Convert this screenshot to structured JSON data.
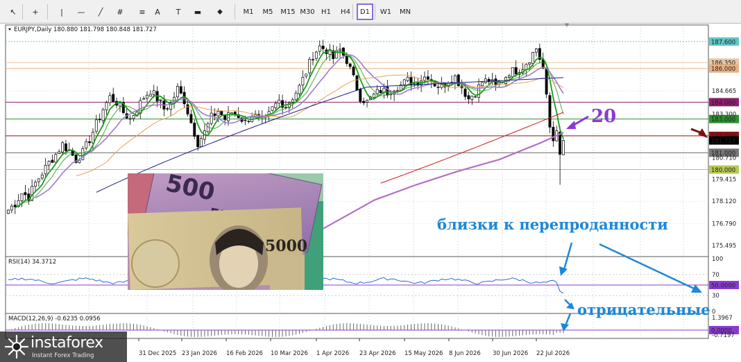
{
  "toolbar": {
    "tools": [
      {
        "name": "cursor-icon",
        "glyph": "↖"
      },
      {
        "name": "crosshair-icon",
        "glyph": "+"
      },
      {
        "name": "vertical-line-icon",
        "glyph": "|"
      },
      {
        "name": "horizontal-line-icon",
        "glyph": "—"
      },
      {
        "name": "trendline-icon",
        "glyph": "╱"
      },
      {
        "name": "equidistant-channel-icon",
        "glyph": "#"
      },
      {
        "name": "fibonacci-icon",
        "glyph": "≡"
      },
      {
        "name": "text-icon",
        "glyph": "A"
      },
      {
        "name": "text-label-icon",
        "glyph": "T"
      },
      {
        "name": "rectangle-icon",
        "glyph": "▬"
      },
      {
        "name": "arrows-icon",
        "glyph": "⬥"
      }
    ],
    "timeframes": [
      "M1",
      "M5",
      "M15",
      "M30",
      "H1",
      "H4",
      "D1",
      "W1",
      "MN"
    ],
    "active_timeframe": "D1"
  },
  "chart_header": {
    "symbol_line": "EURJPY,Daily  180.880 181.798 180.848 181.727"
  },
  "rsi_header": "RSI(14) 34.3712",
  "macd_header": "MACD(12,26,9) -0.6235 0.0956",
  "annotations": {
    "number_label": "20",
    "oversold_text": "близки к перепроданности",
    "negative_text": "отрицательные"
  },
  "logo": {
    "brand": "instaforex",
    "tagline": "Instant Forex Trading"
  },
  "colors": {
    "candle": "#000000",
    "ma_green": "#1a9a1a",
    "ma_lavender": "#9e7ad0",
    "ma_navy": "#1c1c8c",
    "ma_red": "#cc1b1b",
    "ma_orange": "#e2a35a",
    "ma_purple_long": "#b070c8",
    "rsi_line": "#2b6ad4",
    "annotation_blue": "#1e88d6",
    "annotation_purple": "#8a3ad2",
    "arrow_darkred": "#7a1010"
  },
  "chart_data": [
    {
      "type": "candlestick",
      "title": "EURJPY,Daily",
      "ohlc_last": {
        "open": 180.88,
        "high": 181.798,
        "low": 180.848,
        "close": 181.727
      },
      "x_tick_labels": [
        "31 Dec 2025",
        "23 Jan 2026",
        "16 Feb 2026",
        "10 Mar 2026",
        "1 Apr 2026",
        "23 Apr 2026",
        "15 May 2026",
        "8 Jun 2026",
        "30 Jun 2026",
        "22 Jul 2026"
      ],
      "y_tick_labels": [
        187.6,
        186.35,
        186.0,
        184.665,
        184.0,
        183.3,
        183.0,
        182.0,
        181.727,
        181.0,
        180.71,
        180.0,
        179.415,
        178.12,
        176.79,
        175.495
      ],
      "ylim": [
        175.0,
        188.5
      ],
      "horizontal_levels": [
        {
          "value": 187.6,
          "color": "#5fc6c6",
          "style": "dotted"
        },
        {
          "value": 186.35,
          "color": "#e8c6a0",
          "style": "solid"
        },
        {
          "value": 186.0,
          "color": "#e8b080",
          "style": "solid"
        },
        {
          "value": 184.0,
          "color": "#8e1e6e",
          "style": "solid"
        },
        {
          "value": 183.0,
          "color": "#2f8f2f",
          "style": "solid"
        },
        {
          "value": 182.0,
          "color": "#8e1010",
          "style": "solid"
        },
        {
          "value": 181.0,
          "color": "#666666",
          "style": "solid"
        },
        {
          "value": 180.0,
          "color": "#b8c850",
          "style": "solid"
        }
      ],
      "price_tags": [
        {
          "value": 187.6,
          "label": "187.600",
          "bg": "#5fc6c6",
          "fg": "#ffffff"
        },
        {
          "value": 186.35,
          "label": "186.350",
          "bg": "#e8c6a0",
          "fg": "#ffffff"
        },
        {
          "value": 186.0,
          "label": "186.000",
          "bg": "#e8b080",
          "fg": "#ffffff"
        },
        {
          "value": 184.0,
          "label": "184.000",
          "bg": "#8e1e6e",
          "fg": "#ffffff"
        },
        {
          "value": 183.0,
          "label": "183.000",
          "bg": "#2f8f2f",
          "fg": "#ffffff"
        },
        {
          "value": 182.0,
          "label": "182.000",
          "bg": "#8e1010",
          "fg": "#ffffff"
        },
        {
          "value": 181.727,
          "label": "181.727",
          "bg": "#000000",
          "fg": "#ffffff"
        },
        {
          "value": 181.0,
          "label": "181.000",
          "bg": "#777777",
          "fg": "#ffffff"
        },
        {
          "value": 180.0,
          "label": "180.000",
          "bg": "#b8c850",
          "fg": "#ffffff"
        }
      ],
      "plain_ticks": [
        {
          "value": 184.665,
          "label": "184.665"
        },
        {
          "value": 183.3,
          "label": "183.300"
        },
        {
          "value": 180.71,
          "label": "180.710"
        },
        {
          "value": 179.415,
          "label": "179.415"
        },
        {
          "value": 178.12,
          "label": "178.120"
        },
        {
          "value": 176.79,
          "label": "176.790"
        },
        {
          "value": 175.495,
          "label": "175.495"
        }
      ],
      "close_path": [
        177.6,
        178.0,
        178.6,
        178.4,
        179.2,
        179.8,
        180.4,
        180.9,
        181.5,
        181.1,
        180.6,
        181.0,
        181.8,
        182.7,
        183.6,
        184.3,
        184.0,
        183.4,
        183.0,
        183.6,
        184.3,
        184.7,
        184.2,
        183.6,
        183.9,
        184.8,
        184.1,
        182.8,
        181.6,
        182.2,
        183.1,
        183.5,
        183.0,
        183.4,
        183.2,
        182.8,
        183.3,
        183.0,
        182.9,
        183.6,
        184.1,
        183.8,
        184.3,
        184.9,
        185.8,
        186.8,
        187.3,
        187.1,
        186.6,
        187.1,
        186.5,
        185.4,
        184.3,
        184.0,
        184.4,
        184.7,
        184.6,
        184.9,
        185.0,
        185.3,
        185.1,
        185.4,
        185.6,
        185.1,
        184.9,
        185.3,
        185.5,
        184.9,
        184.2,
        184.6,
        185.2,
        185.3,
        184.9,
        185.3,
        185.8,
        185.9,
        186.1,
        186.6,
        187.2,
        186.0,
        182.5,
        181.0,
        181.7
      ],
      "series": [
        {
          "name": "MA fast green",
          "color": "#1a9a1a"
        },
        {
          "name": "MA lavender",
          "color": "#9e7ad0"
        },
        {
          "name": "MA navy",
          "color": "#1c1c8c"
        },
        {
          "name": "MA red",
          "color": "#cc1b1b"
        },
        {
          "name": "MA orange",
          "color": "#e2a35a"
        },
        {
          "name": "MA purple long",
          "color": "#b070c8"
        }
      ]
    },
    {
      "type": "line",
      "title": "RSI(14) 34.3712",
      "current": 34.3712,
      "ylim": [
        0,
        100
      ],
      "y_tick_labels": [
        100,
        70,
        50,
        30,
        0
      ],
      "levels": [
        {
          "value": 50,
          "label": "50.0000",
          "bg": "#8a3ad2"
        }
      ]
    },
    {
      "type": "bar",
      "title": "MACD(12,26,9) -0.6235 0.0956",
      "main": -0.6235,
      "signal": 0.0956,
      "y_tick_labels": [
        1.3967,
        0.0,
        -0.7197
      ],
      "levels": [
        {
          "value": 0.0,
          "label": "0.0000",
          "bg": "#8a3ad2"
        }
      ]
    }
  ]
}
